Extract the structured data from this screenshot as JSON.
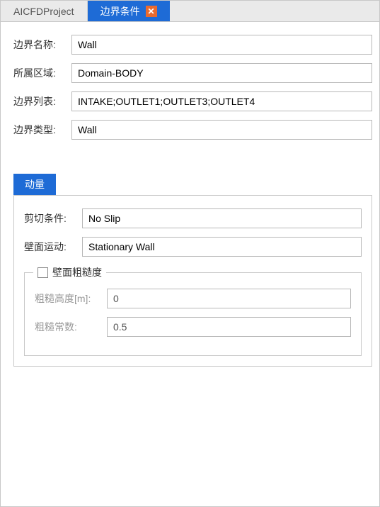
{
  "tabs": {
    "project": "AICFDProject",
    "active": "边界条件"
  },
  "icons": {
    "close": "✕"
  },
  "fields": {
    "name_label": "边界名称:",
    "name_value": "Wall",
    "domain_label": "所属区域:",
    "domain_value": "Domain-BODY",
    "list_label": "边界列表:",
    "list_value": "INTAKE;OUTLET1;OUTLET3;OUTLET4",
    "type_label": "边界类型:",
    "type_value": "Wall"
  },
  "subtab": {
    "momentum": "动量"
  },
  "panel": {
    "shear_label": "剪切条件:",
    "shear_value": "No Slip",
    "wallmotion_label": "壁面运动:",
    "wallmotion_value": "Stationary Wall"
  },
  "roughness": {
    "legend": "壁面粗糙度",
    "height_label": "粗糙高度[m]:",
    "height_value": "0",
    "constant_label": "粗糙常数:",
    "constant_value": "0.5"
  }
}
